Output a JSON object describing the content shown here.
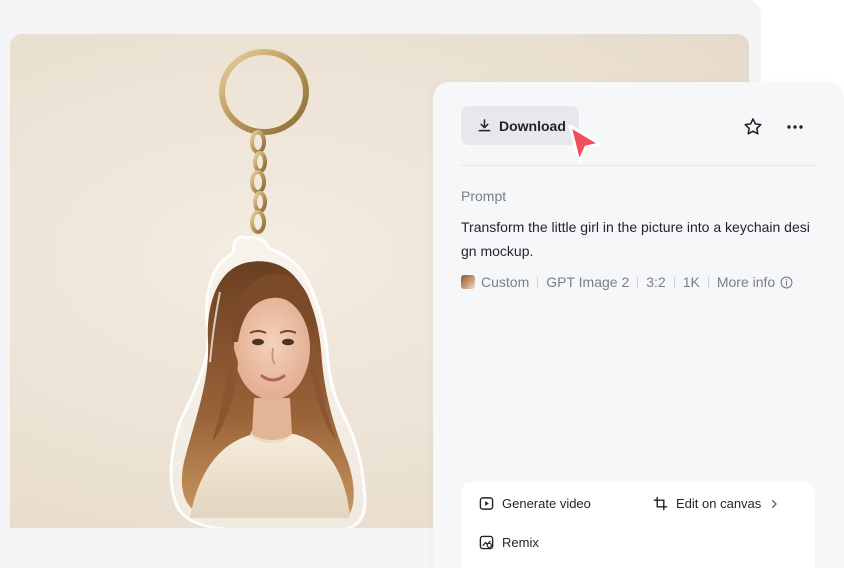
{
  "panel": {
    "download_label": "Download",
    "prompt_label": "Prompt",
    "prompt_text": "Transform the little girl in the picture into a keychain design mockup.",
    "meta": {
      "style": "Custom",
      "model": "GPT Image 2",
      "ratio": "3:2",
      "resolution": "1K",
      "more_info": "More info"
    }
  },
  "actions": {
    "generate_video": "Generate video",
    "edit_on_canvas": "Edit on canvas",
    "remix": "Remix"
  },
  "colors": {
    "panel_bg": "#f6f7f9",
    "button_bg": "#e6e8ec",
    "cursor": "#f0505a",
    "muted_text": "#7a7f87"
  },
  "icons": [
    "download-icon",
    "star-icon",
    "more-icon",
    "info-icon",
    "video-icon",
    "crop-icon",
    "chevron-right-icon",
    "remix-icon",
    "cursor-pointer-icon"
  ]
}
